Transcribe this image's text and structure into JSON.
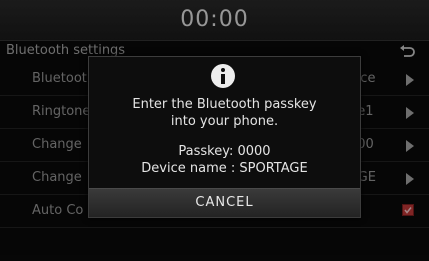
{
  "header": {
    "clock": "00:00"
  },
  "settings": {
    "title": "Bluetooth settings",
    "rows": [
      {
        "label": "Bluetoot",
        "value": "vice",
        "control": "arrow"
      },
      {
        "label": "Ringtone",
        "value": "ne1",
        "control": "arrow"
      },
      {
        "label": "Change",
        "value": "000",
        "control": "arrow"
      },
      {
        "label": "Change",
        "value": "AGE",
        "control": "arrow"
      },
      {
        "label": "Auto Co",
        "value": "",
        "control": "checkbox",
        "checked": true
      }
    ]
  },
  "dialog": {
    "icon": "info-icon",
    "message_line1": "Enter the Bluetooth passkey",
    "message_line2": "into your phone.",
    "passkey_line": "Passkey: 0000",
    "device_line": "Device name : SPORTAGE",
    "cancel_label": "CANCEL"
  },
  "colors": {
    "checkbox_accent": "#c53a3a",
    "background": "#0a0a0a"
  }
}
